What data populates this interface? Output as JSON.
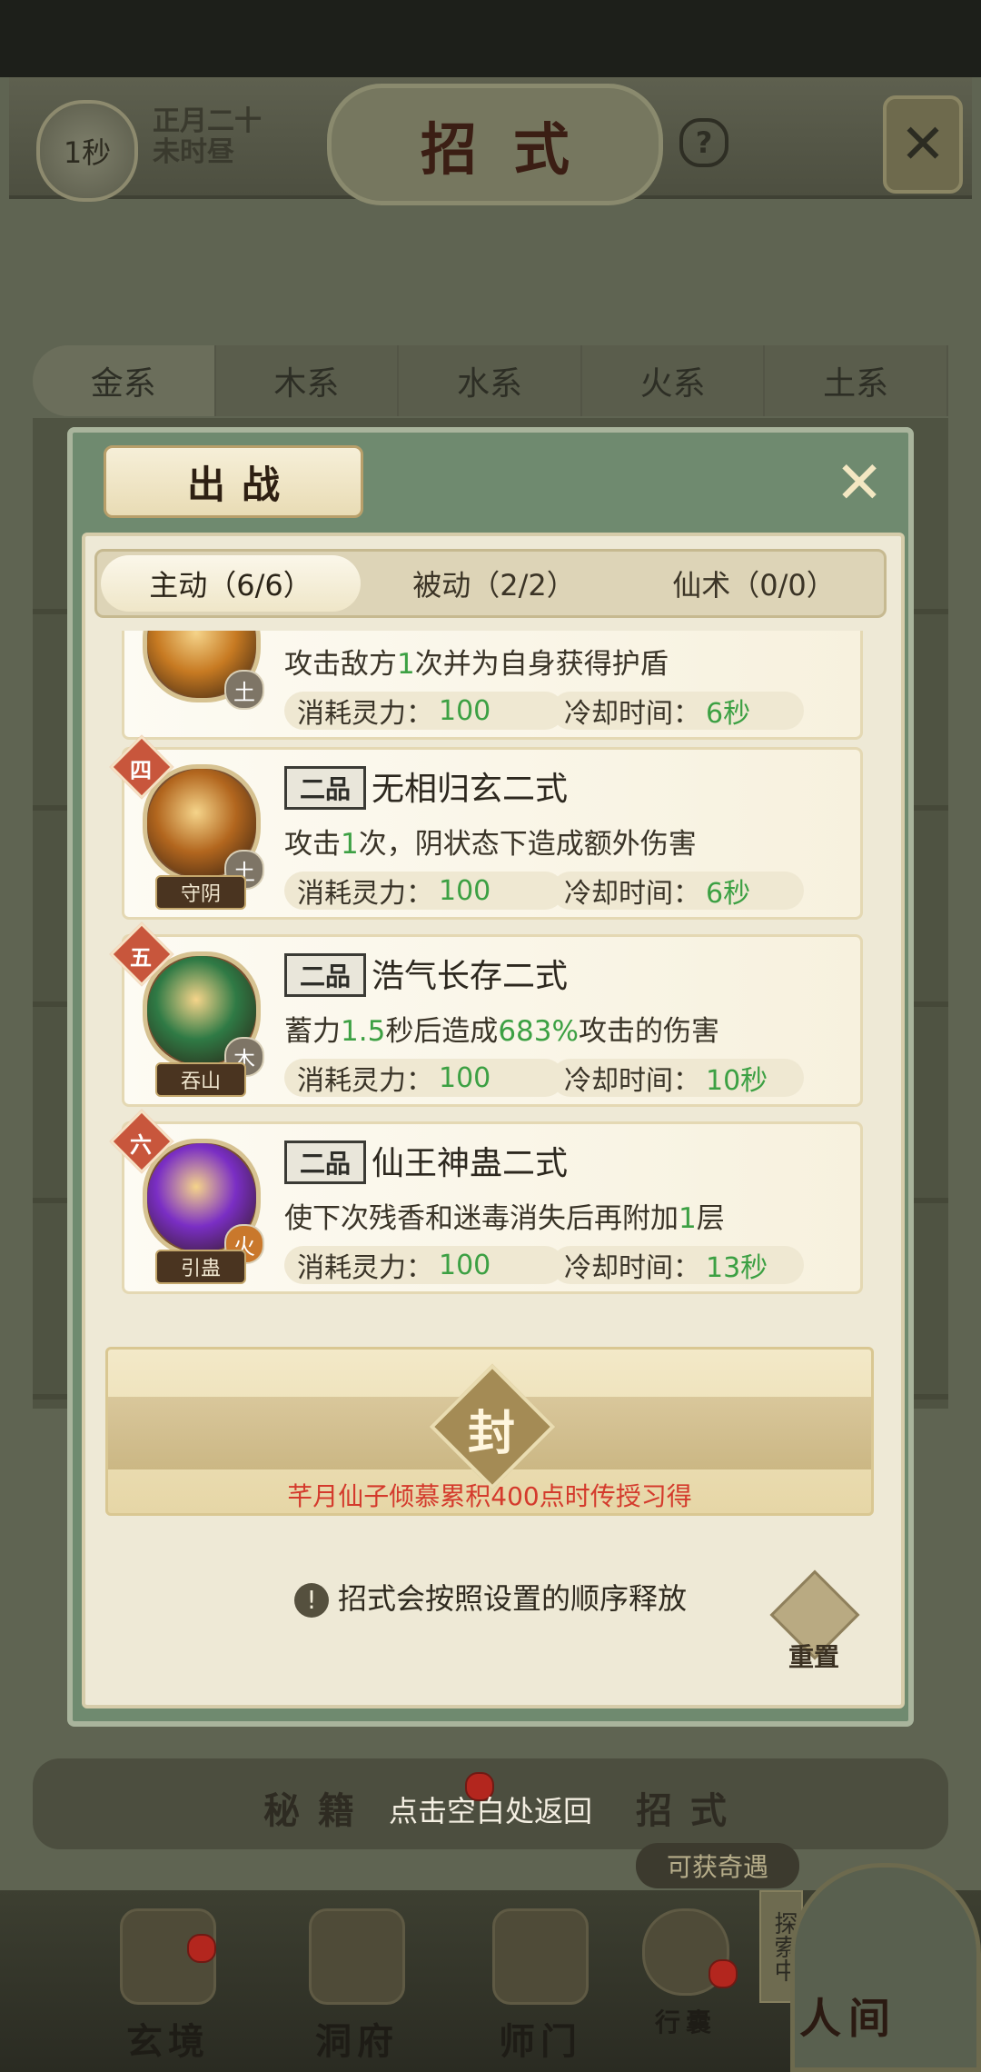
{
  "hud": {
    "timer": "1秒",
    "date_line1": "正月二十",
    "date_line2": "未时昼",
    "title": "招式",
    "help": "?",
    "close": "✕"
  },
  "element_tabs": [
    "金系",
    "木系",
    "水系",
    "火系",
    "土系"
  ],
  "modal": {
    "title": "出战",
    "close": "✕",
    "sub_tabs": [
      "主动（6/6）",
      "被动（2/2）",
      "仙术（0/0）"
    ],
    "active_sub_tab": 0,
    "skills": [
      {
        "order": "",
        "grade": "",
        "name": "",
        "desc_parts": [
          "攻击敌方",
          "1",
          "次并为自身获得护盾"
        ],
        "cost_label": "消耗灵力：",
        "cost": "100",
        "cd_label": "冷却时间：",
        "cd": "6秒",
        "element": "土",
        "tag": "",
        "icon_color": "#c77a22"
      },
      {
        "order": "四",
        "grade": "二品",
        "name": "无相归玄二式",
        "desc_parts": [
          "攻击",
          "1",
          "次，阴状态下造成额外伤害"
        ],
        "cost_label": "消耗灵力：",
        "cost": "100",
        "cd_label": "冷却时间：",
        "cd": "6秒",
        "element": "土",
        "tag": "守阴",
        "icon_color": "#b2661e"
      },
      {
        "order": "五",
        "grade": "二品",
        "name": "浩气长存二式",
        "desc_parts": [
          "蓄力",
          "1.5",
          "秒后造成",
          "683%",
          "攻击的伤害"
        ],
        "cost_label": "消耗灵力：",
        "cost": "100",
        "cd_label": "冷却时间：",
        "cd": "10秒",
        "element": "木",
        "tag": "吞山",
        "icon_color": "#2f7a45"
      },
      {
        "order": "六",
        "grade": "二品",
        "name": "仙王神蛊二式",
        "desc_parts": [
          "使下次残香和迷毒消失后再附加",
          "1",
          "层"
        ],
        "cost_label": "消耗灵力：",
        "cost": "100",
        "cd_label": "冷却时间：",
        "cd": "13秒",
        "element": "火",
        "tag": "引蛊",
        "icon_color": "#7a2ec4"
      }
    ],
    "sealed": {
      "seal_char": "封",
      "condition": "芊月仙子倾慕累积400点时传授习得"
    },
    "note_icon": "!",
    "note": "招式会按照设置的顺序释放",
    "reset": "重置"
  },
  "bottom": {
    "tab_left": "秘籍",
    "tab_right": "招式",
    "hint": "点击空白处返回",
    "adventure": "可获奇遇",
    "explore": "探索中",
    "nav": [
      "玄境",
      "洞府",
      "师门",
      "行囊"
    ],
    "world": "人间"
  }
}
